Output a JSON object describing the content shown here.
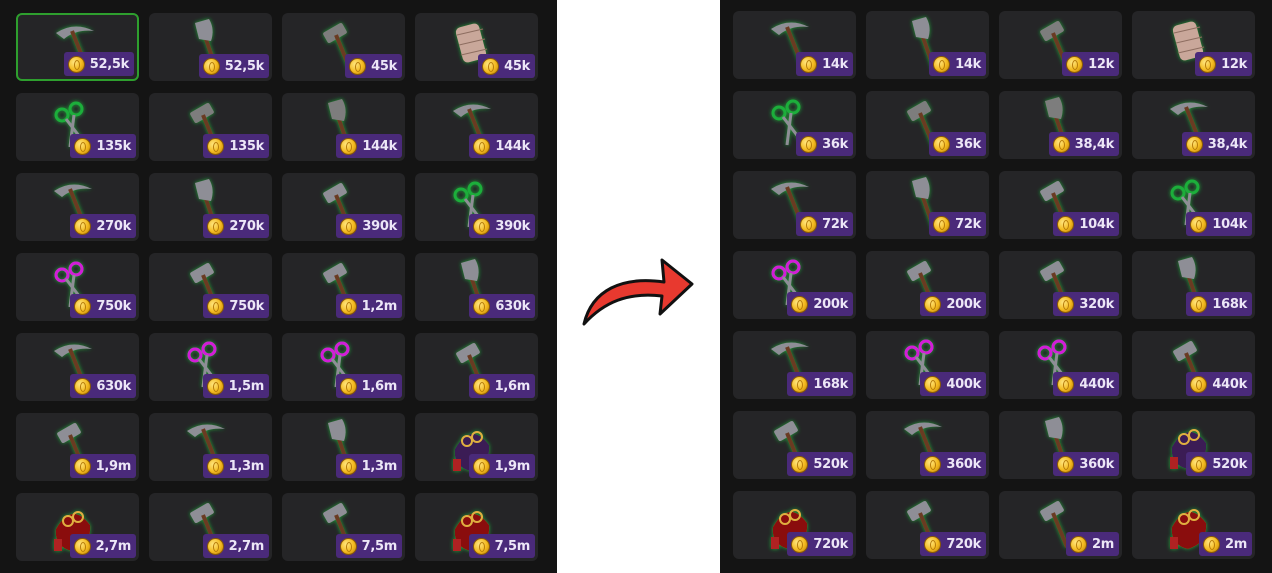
{
  "before": {
    "items": [
      {
        "icon": "pickaxe-icon",
        "tier": "green",
        "price": "52,5k",
        "selected": true
      },
      {
        "icon": "axe-icon",
        "tier": "green",
        "price": "52,5k"
      },
      {
        "icon": "hammer-icon",
        "tier": "grey",
        "price": "45k"
      },
      {
        "icon": "thread-spool-icon",
        "tier": "grey",
        "price": "45k"
      },
      {
        "icon": "scissors-icon",
        "tier": "green",
        "price": "135k"
      },
      {
        "icon": "hammer-icon",
        "tier": "grey",
        "price": "135k"
      },
      {
        "icon": "axe-icon",
        "tier": "grey",
        "price": "144k"
      },
      {
        "icon": "pickaxe-icon",
        "tier": "green",
        "price": "144k"
      },
      {
        "icon": "pickaxe-icon",
        "tier": "purple",
        "price": "270k"
      },
      {
        "icon": "axe-icon",
        "tier": "purple",
        "price": "270k"
      },
      {
        "icon": "hammer-icon",
        "tier": "green",
        "price": "390k"
      },
      {
        "icon": "scissors-icon",
        "tier": "green",
        "price": "390k"
      },
      {
        "icon": "scissors-icon",
        "tier": "purple",
        "price": "750k"
      },
      {
        "icon": "hammer-icon",
        "tier": "purple",
        "price": "750k"
      },
      {
        "icon": "hammer-icon",
        "tier": "purple",
        "price": "1,2m"
      },
      {
        "icon": "axe-icon",
        "tier": "purple",
        "price": "630k"
      },
      {
        "icon": "pickaxe-icon",
        "tier": "purple",
        "price": "630k"
      },
      {
        "icon": "scissors-icon",
        "tier": "purple",
        "price": "1,5m"
      },
      {
        "icon": "scissors-icon",
        "tier": "purple",
        "price": "1,6m"
      },
      {
        "icon": "hammer-icon",
        "tier": "purple",
        "price": "1,6m"
      },
      {
        "icon": "hammer-icon",
        "tier": "purple",
        "price": "1,9m"
      },
      {
        "icon": "pickaxe-icon",
        "tier": "red",
        "price": "1,3m"
      },
      {
        "icon": "axe-icon",
        "tier": "red",
        "price": "1,3m"
      },
      {
        "icon": "sewing-kit-icon",
        "tier": "purple",
        "price": "1,9m"
      },
      {
        "icon": "sewing-kit-icon",
        "tier": "red",
        "price": "2,7m"
      },
      {
        "icon": "hammer-icon",
        "tier": "red",
        "price": "2,7m"
      },
      {
        "icon": "hammer-icon",
        "tier": "red",
        "price": "7,5m"
      },
      {
        "icon": "sewing-kit-icon",
        "tier": "red",
        "price": "7,5m"
      }
    ]
  },
  "after": {
    "items": [
      {
        "icon": "pickaxe-icon",
        "tier": "green",
        "price": "14k"
      },
      {
        "icon": "axe-icon",
        "tier": "green",
        "price": "14k"
      },
      {
        "icon": "hammer-icon",
        "tier": "grey",
        "price": "12k"
      },
      {
        "icon": "thread-spool-icon",
        "tier": "grey",
        "price": "12k"
      },
      {
        "icon": "scissors-icon",
        "tier": "green",
        "price": "36k"
      },
      {
        "icon": "hammer-icon",
        "tier": "grey",
        "price": "36k"
      },
      {
        "icon": "axe-icon",
        "tier": "grey",
        "price": "38,4k"
      },
      {
        "icon": "pickaxe-icon",
        "tier": "green",
        "price": "38,4k"
      },
      {
        "icon": "pickaxe-icon",
        "tier": "purple",
        "price": "72k"
      },
      {
        "icon": "axe-icon",
        "tier": "purple",
        "price": "72k"
      },
      {
        "icon": "hammer-icon",
        "tier": "green",
        "price": "104k"
      },
      {
        "icon": "scissors-icon",
        "tier": "green",
        "price": "104k"
      },
      {
        "icon": "scissors-icon",
        "tier": "purple",
        "price": "200k"
      },
      {
        "icon": "hammer-icon",
        "tier": "purple",
        "price": "200k"
      },
      {
        "icon": "hammer-icon",
        "tier": "purple",
        "price": "320k"
      },
      {
        "icon": "axe-icon",
        "tier": "purple",
        "price": "168k"
      },
      {
        "icon": "pickaxe-icon",
        "tier": "purple",
        "price": "168k"
      },
      {
        "icon": "scissors-icon",
        "tier": "purple",
        "price": "400k"
      },
      {
        "icon": "scissors-icon",
        "tier": "purple",
        "price": "440k"
      },
      {
        "icon": "hammer-icon",
        "tier": "purple",
        "price": "440k"
      },
      {
        "icon": "hammer-icon",
        "tier": "purple",
        "price": "520k"
      },
      {
        "icon": "pickaxe-icon",
        "tier": "red",
        "price": "360k"
      },
      {
        "icon": "axe-icon",
        "tier": "red",
        "price": "360k"
      },
      {
        "icon": "sewing-kit-icon",
        "tier": "purple",
        "price": "520k"
      },
      {
        "icon": "sewing-kit-icon",
        "tier": "red",
        "price": "720k"
      },
      {
        "icon": "hammer-icon",
        "tier": "red",
        "price": "720k"
      },
      {
        "icon": "hammer-icon",
        "tier": "red",
        "price": "2m"
      },
      {
        "icon": "sewing-kit-icon",
        "tier": "red",
        "price": "2m"
      }
    ]
  },
  "arrow_icon": "curved-arrow-right-icon",
  "colors": {
    "panel_bg": "#141414",
    "cell_bg": "#252527",
    "price_bg": "#4a2a7a",
    "selected_border": "#2e9f2e",
    "arrow_fill": "#e8392f",
    "tier_green": "#1fae3a",
    "tier_purple": "#d21fd8",
    "tier_red": "#e3221f",
    "tier_grey": "#9a9a9a"
  }
}
